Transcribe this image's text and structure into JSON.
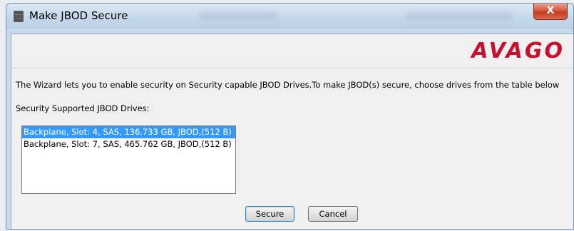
{
  "window": {
    "title": "Make JBOD Secure",
    "close_glyph": "X",
    "title_icon": "disk-array-icon"
  },
  "branding": {
    "logo_text": "AVAGO",
    "logo_color": "#c8102e"
  },
  "content": {
    "description": "The Wizard lets you to enable security on Security capable JBOD Drives.To make JBOD(s) secure, choose drives from the table below",
    "list_label": "Security Supported JBOD Drives:",
    "drives": [
      {
        "label": "Backplane, Slot: 4, SAS, 136.733 GB, JBOD,(512 B)",
        "selected": true
      },
      {
        "label": "Backplane, Slot: 7, SAS, 465.762 GB, JBOD,(512 B)",
        "selected": false
      }
    ]
  },
  "buttons": {
    "secure": "Secure",
    "cancel": "Cancel"
  },
  "colors": {
    "selection": "#3399ff",
    "close_button": "#c7381f"
  }
}
